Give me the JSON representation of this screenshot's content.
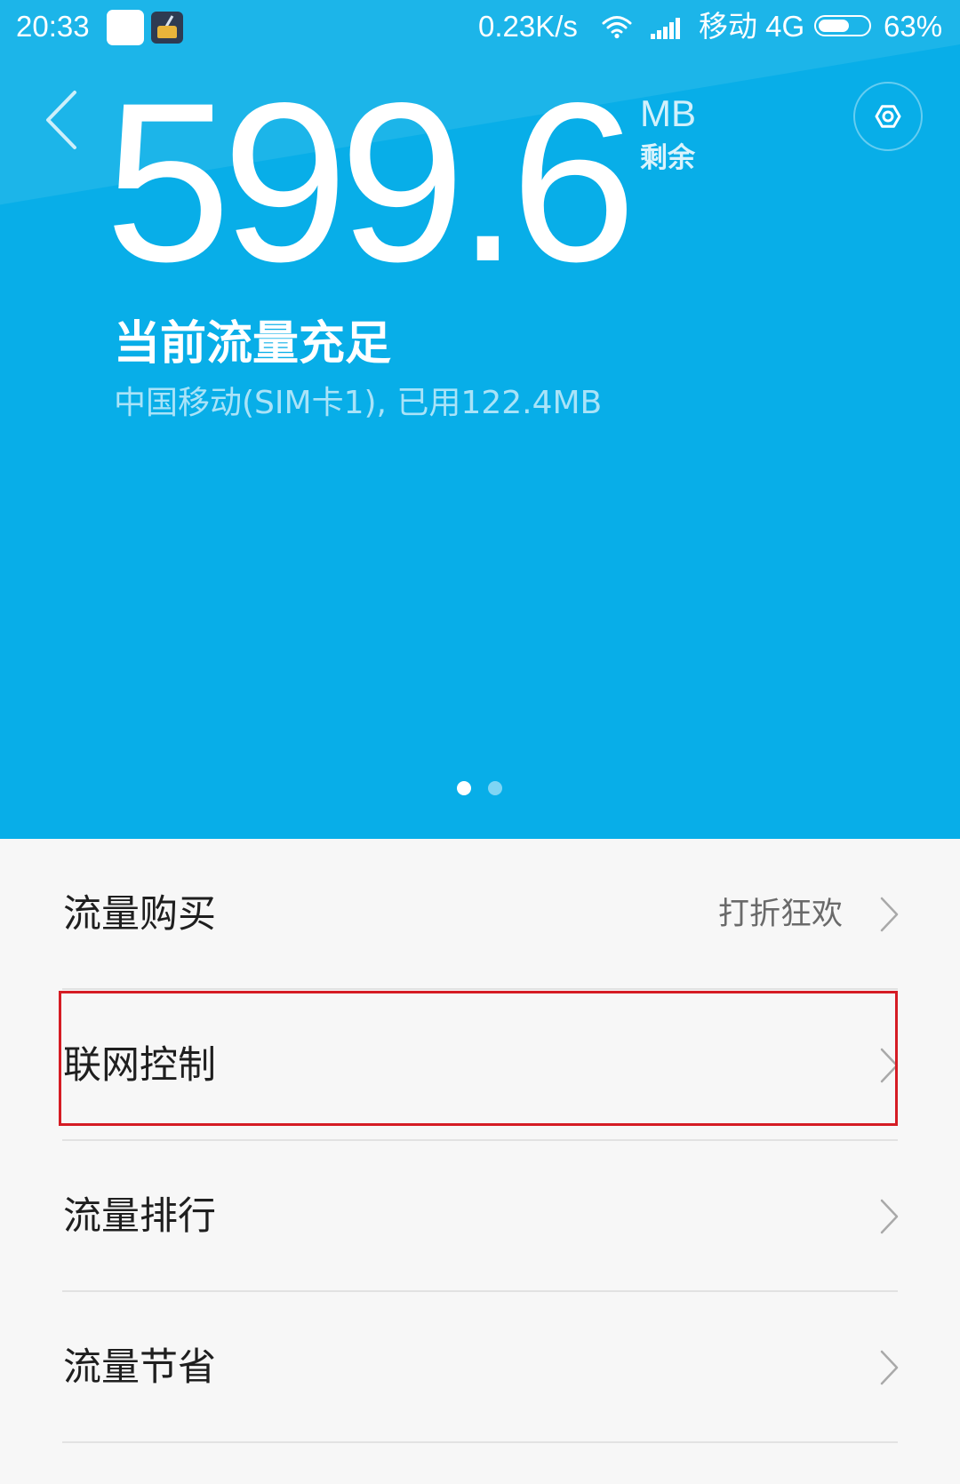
{
  "status_bar": {
    "time": "20:33",
    "net_speed": "0.23K/s",
    "carrier": "移动 4G",
    "battery_percent": "63%",
    "battery_level": 0.63,
    "icons": [
      "notification-icon",
      "cleaner-app-icon",
      "wifi-icon",
      "signal-icon",
      "battery-icon"
    ]
  },
  "header": {
    "back_icon": "chevron-left-icon",
    "remaining_value": "599.6",
    "unit": "MB",
    "unit_caption": "剩余",
    "settings_icon": "gear-icon",
    "status_title": "当前流量充足",
    "status_detail": "中国移动(SIM卡1), 已用122.4MB",
    "page_count": 2,
    "active_page": 1
  },
  "menu": [
    {
      "label": "流量购买",
      "hint": "打折狂欢"
    },
    {
      "label": "联网控制"
    },
    {
      "label": "流量排行"
    },
    {
      "label": "流量节省"
    }
  ],
  "colors": {
    "header_bg": "#08aee8",
    "list_bg": "#f7f7f7",
    "highlight": "#d51c24"
  }
}
